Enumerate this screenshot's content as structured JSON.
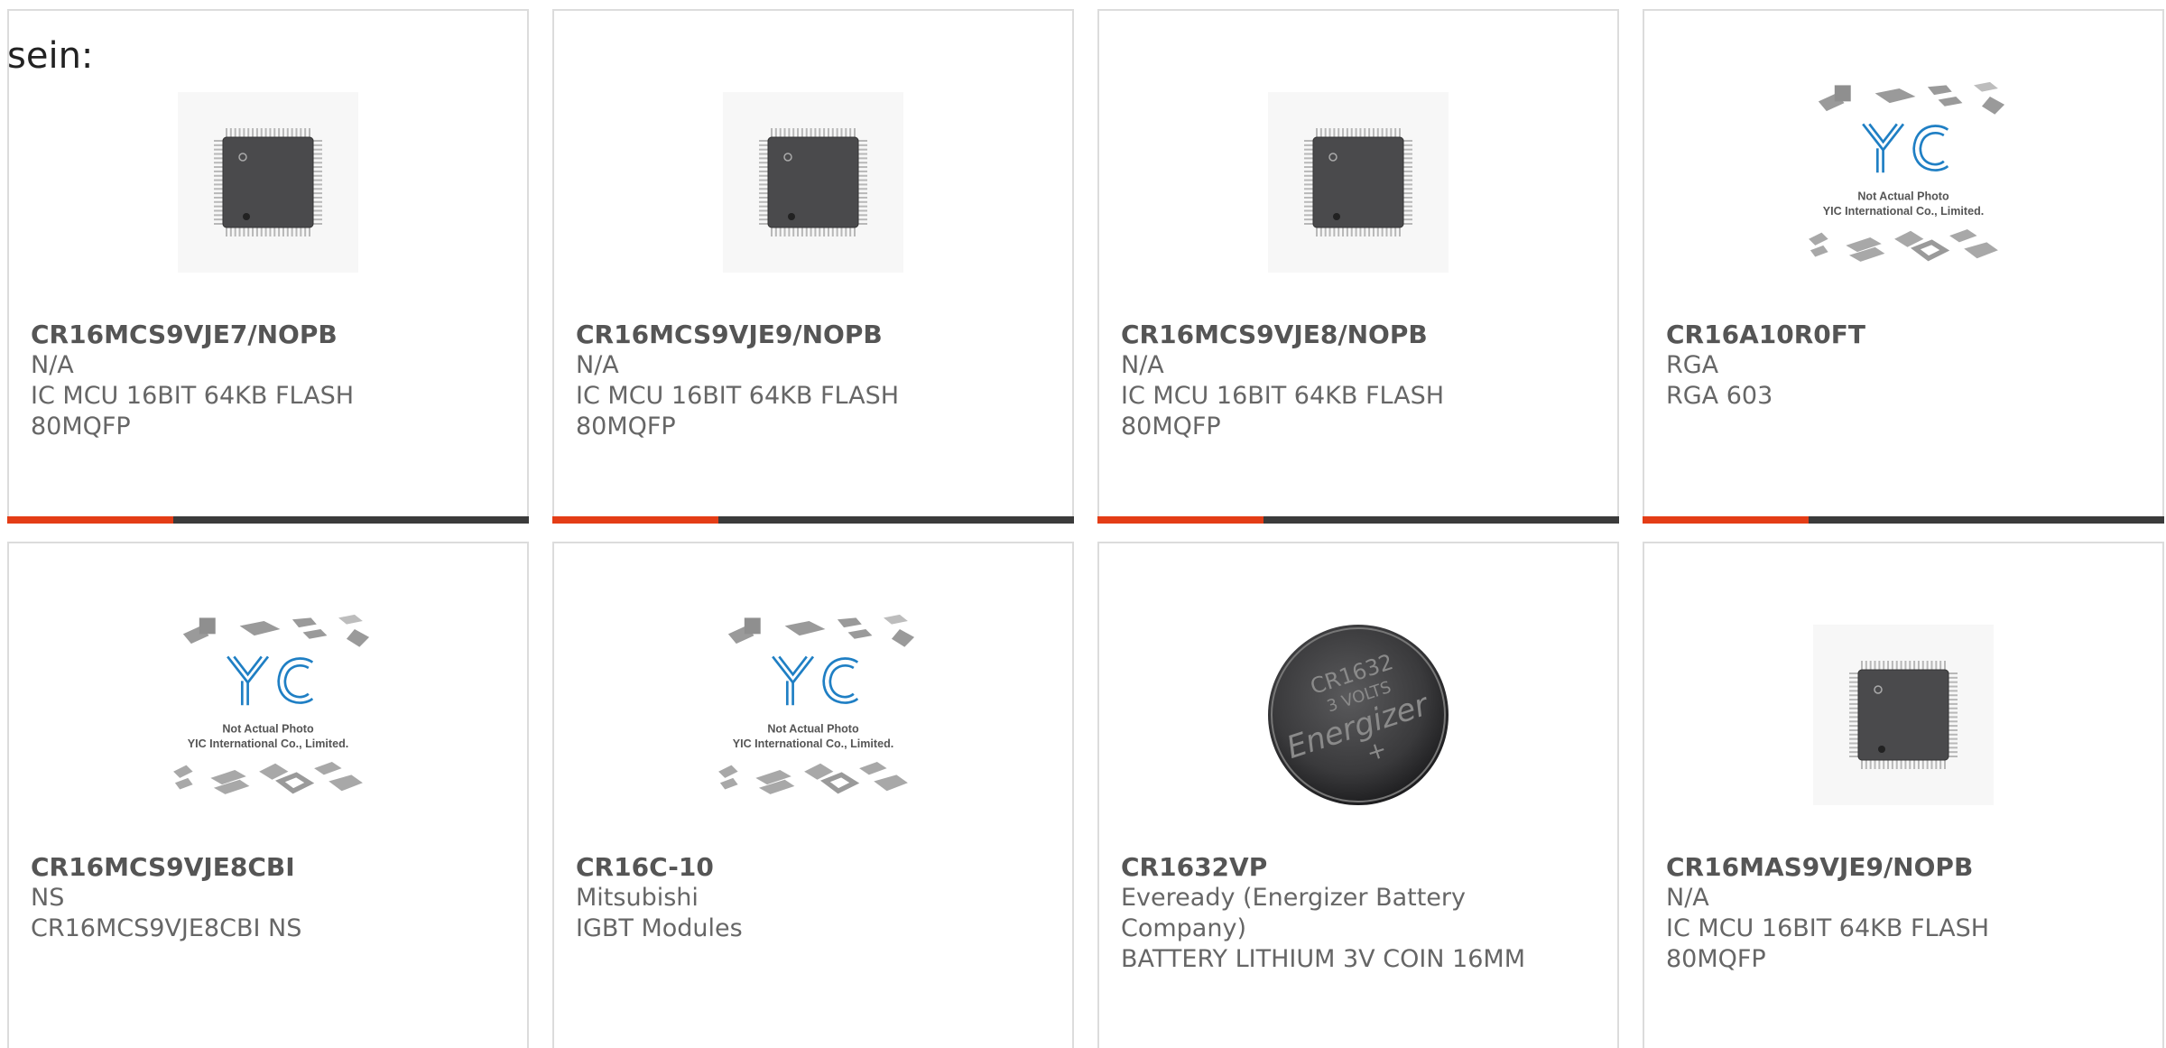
{
  "intro_text": "sein:",
  "placeholder": {
    "line1": "Not Actual Photo",
    "line2": "YIC International Co., Limited.",
    "logo": "YIC"
  },
  "battery_label": {
    "line1": "CR1632",
    "line2": "3 VOLTS",
    "line3": "Energizer",
    "line4": "+"
  },
  "colors": {
    "accent": "#e43d16",
    "bar": "#3b3b3b",
    "logo_blue": "#1f7fc4"
  },
  "products": [
    {
      "part_number": "CR16MCS9VJE7/NOPB",
      "manufacturer": "N/A",
      "description": "IC MCU 16BIT 64KB FLASH 80MQFP",
      "image": "qfp-chip-icon"
    },
    {
      "part_number": "CR16MCS9VJE9/NOPB",
      "manufacturer": "N/A",
      "description": "IC MCU 16BIT 64KB FLASH 80MQFP",
      "image": "qfp-chip-icon"
    },
    {
      "part_number": "CR16MCS9VJE8/NOPB",
      "manufacturer": "N/A",
      "description": "IC MCU 16BIT 64KB FLASH 80MQFP",
      "image": "qfp-chip-icon"
    },
    {
      "part_number": "CR16A10R0FT",
      "manufacturer": "RGA",
      "description": "RGA 603",
      "image": "placeholder-image"
    },
    {
      "part_number": "CR16MCS9VJE8CBI",
      "manufacturer": "NS",
      "description": "CR16MCS9VJE8CBI NS",
      "image": "placeholder-image"
    },
    {
      "part_number": "CR16C-10",
      "manufacturer": "Mitsubishi",
      "description": "IGBT Modules",
      "image": "placeholder-image"
    },
    {
      "part_number": "CR1632VP",
      "manufacturer": "Eveready (Energizer Battery Company)",
      "description": "BATTERY LITHIUM 3V COIN 16MM",
      "image": "coin-battery-icon"
    },
    {
      "part_number": "CR16MAS9VJE9/NOPB",
      "manufacturer": "N/A",
      "description": "IC MCU 16BIT 64KB FLASH 80MQFP",
      "image": "qfp-chip-icon"
    }
  ]
}
